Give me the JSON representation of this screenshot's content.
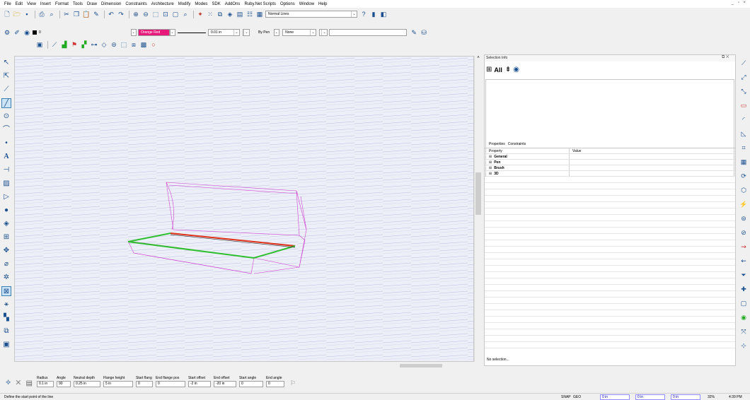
{
  "menu": [
    "File",
    "Edit",
    "View",
    "Insert",
    "Format",
    "Tools",
    "Draw",
    "Dimension",
    "Constraints",
    "Architecture",
    "Modify",
    "Modes",
    "SDK",
    "AddOns",
    "Ruby.Net Scripts",
    "Options",
    "Window",
    "Help"
  ],
  "window_controls": "_ ▫ ×",
  "toolbar": {
    "line_style": "Normal Lines",
    "color_index": "0",
    "brush_color": "Orange Red",
    "line_width": "0.01 in",
    "pen_mode": "By Pen",
    "pattern": "None"
  },
  "selection_panel": {
    "title": "Selection Info",
    "all_label": "All",
    "tab_properties": "Properties",
    "tab_constraints": "Constraints",
    "col_property": "Property",
    "col_value": "Value",
    "groups": [
      "General",
      "Pen",
      "Brush",
      "3D"
    ],
    "status": "No selection..."
  },
  "inspector": [
    {
      "label": "Radius",
      "value": "0.1 in"
    },
    {
      "label": "Angle",
      "value": "90"
    },
    {
      "label": "Neutral depth",
      "value": "0.25 in"
    },
    {
      "label": "Flange height",
      "value": "5 in"
    },
    {
      "label": "Start flang",
      "value": "0"
    },
    {
      "label": "End flange pos",
      "value": "0"
    },
    {
      "label": "Start offset",
      "value": "-2 in"
    },
    {
      "label": "End offset",
      "value": "-20 in"
    },
    {
      "label": "Start angle",
      "value": "0"
    },
    {
      "label": "End angle",
      "value": "0"
    }
  ],
  "statusbar": {
    "prompt": "Define the start point of the line",
    "snap": "SNAP",
    "geo": "GEO",
    "coord1": "0 in",
    "coord2": "0 in",
    "coord3": "0 in",
    "zoom": "32%",
    "time": "4:39 PM"
  },
  "colors": {
    "brush_swatch": "#e8177a",
    "red_edge": "#e03018",
    "green_edge": "#2fbf2f",
    "wire": "#d040d0"
  }
}
